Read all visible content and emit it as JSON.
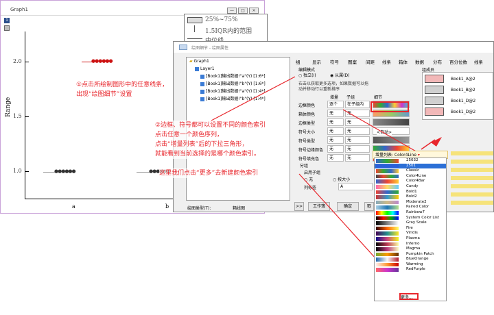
{
  "graph_window": {
    "title": "Graph1",
    "layer_badge": "1",
    "y_axis": {
      "label": "Range",
      "ticks": [
        "2.0",
        "1.5",
        "1.0"
      ]
    },
    "x_axis": {
      "ticks": [
        "a",
        "b"
      ]
    },
    "legend": [
      "25%~75%",
      "1.5IQR内的范围",
      "中位线"
    ],
    "window_controls": [
      "—",
      "□",
      "×"
    ]
  },
  "annotations": {
    "a1_line1": "①点击所绘制图形中的任意线条，",
    "a1_line2": "出现“绘图细节”设置",
    "a2_line1": "②边框、符号都可以设置不同的颜色索引",
    "a2_line2": "点击任意一个颜色序列，",
    "a2_line3": "点击“增量列表”后的下拉三角形，",
    "a2_line4": "就能看到当前选择的是哪个颜色索引。",
    "a3": "这里我们点击“更多”去新建颜色索引"
  },
  "dialog": {
    "title": "绘图细节 - 绘图属性",
    "tree": {
      "root": "Graph1",
      "layer": "Layer1",
      "items": [
        "[Book1]输出数据!\"a\"(Y) [1:6*]",
        "[Book1]输出数据!\"b\"(Y) [1:6*]",
        "[Book1]输出数据!\"a\"(Y) [1:4*]",
        "[Book1]输出数据!\"b\"(Y) [1:4*]"
      ]
    },
    "tabs": [
      "组",
      "显示",
      "符号",
      "图案",
      "间距",
      "线条",
      "箱体",
      "数据",
      "分布",
      "百分位数",
      "线条"
    ],
    "edit_mode_label": "编辑模式",
    "mode_independent": "独立(I)",
    "mode_dependent": "从属(D)",
    "hint_line1": "右击以获取更多选项，如果数据可以拖",
    "hint_line2": "动并移动行以重新排序",
    "col_increment": "增量",
    "col_subgroup": "子组",
    "col_detail": "细节",
    "rows": [
      {
        "label": "边框颜色",
        "inc": "逐个",
        "sub": "在子组内"
      },
      {
        "label": "箱体颜色",
        "inc": "无",
        "sub": "无"
      },
      {
        "label": "边框类型",
        "inc": "无",
        "sub": "无"
      },
      {
        "label": "符号大小",
        "inc": "无",
        "sub": "无"
      },
      {
        "label": "符号类型",
        "inc": "无",
        "sub": "无"
      },
      {
        "label": "符号边缘颜色",
        "inc": "无",
        "sub": "无"
      },
      {
        "label": "符号填充色",
        "inc": "无",
        "sub": "无"
      }
    ],
    "auto_label": "<自动>",
    "group_section": "分组",
    "enable_subgroup": "启用子组",
    "radio_none": "无",
    "radio_by_size": "按大小",
    "col_label_label": "列标签",
    "col_label_value": "A",
    "plot_type_label": "绘图类型(T):",
    "plot_type_value": "箱线图",
    "buttons": {
      "expand": ">>",
      "workbook": "工作簿",
      "ok": "确定",
      "cancel": "取"
    },
    "group_members_title": "组成员",
    "members": [
      "Book1_A@2",
      "Book1_B@2",
      "Book1_D@2",
      "Book1_D@2"
    ]
  },
  "palette_popup": {
    "header": "增量列表: Color4Line",
    "items": [
      "25032",
      "2501",
      "Classic",
      "Color4Line",
      "Color4Bar",
      "Candy",
      "Bold1",
      "Bold2",
      "Moderate2",
      "Paired Color",
      "Rainbow7",
      "System Color List",
      "Gray Scale",
      "Fire",
      "Viridis",
      "Plasma",
      "Inferno",
      "Magma",
      "Pumpkin Patch",
      "BlueOrange",
      "Warming",
      "RedPurple"
    ],
    "more": "更多..."
  }
}
